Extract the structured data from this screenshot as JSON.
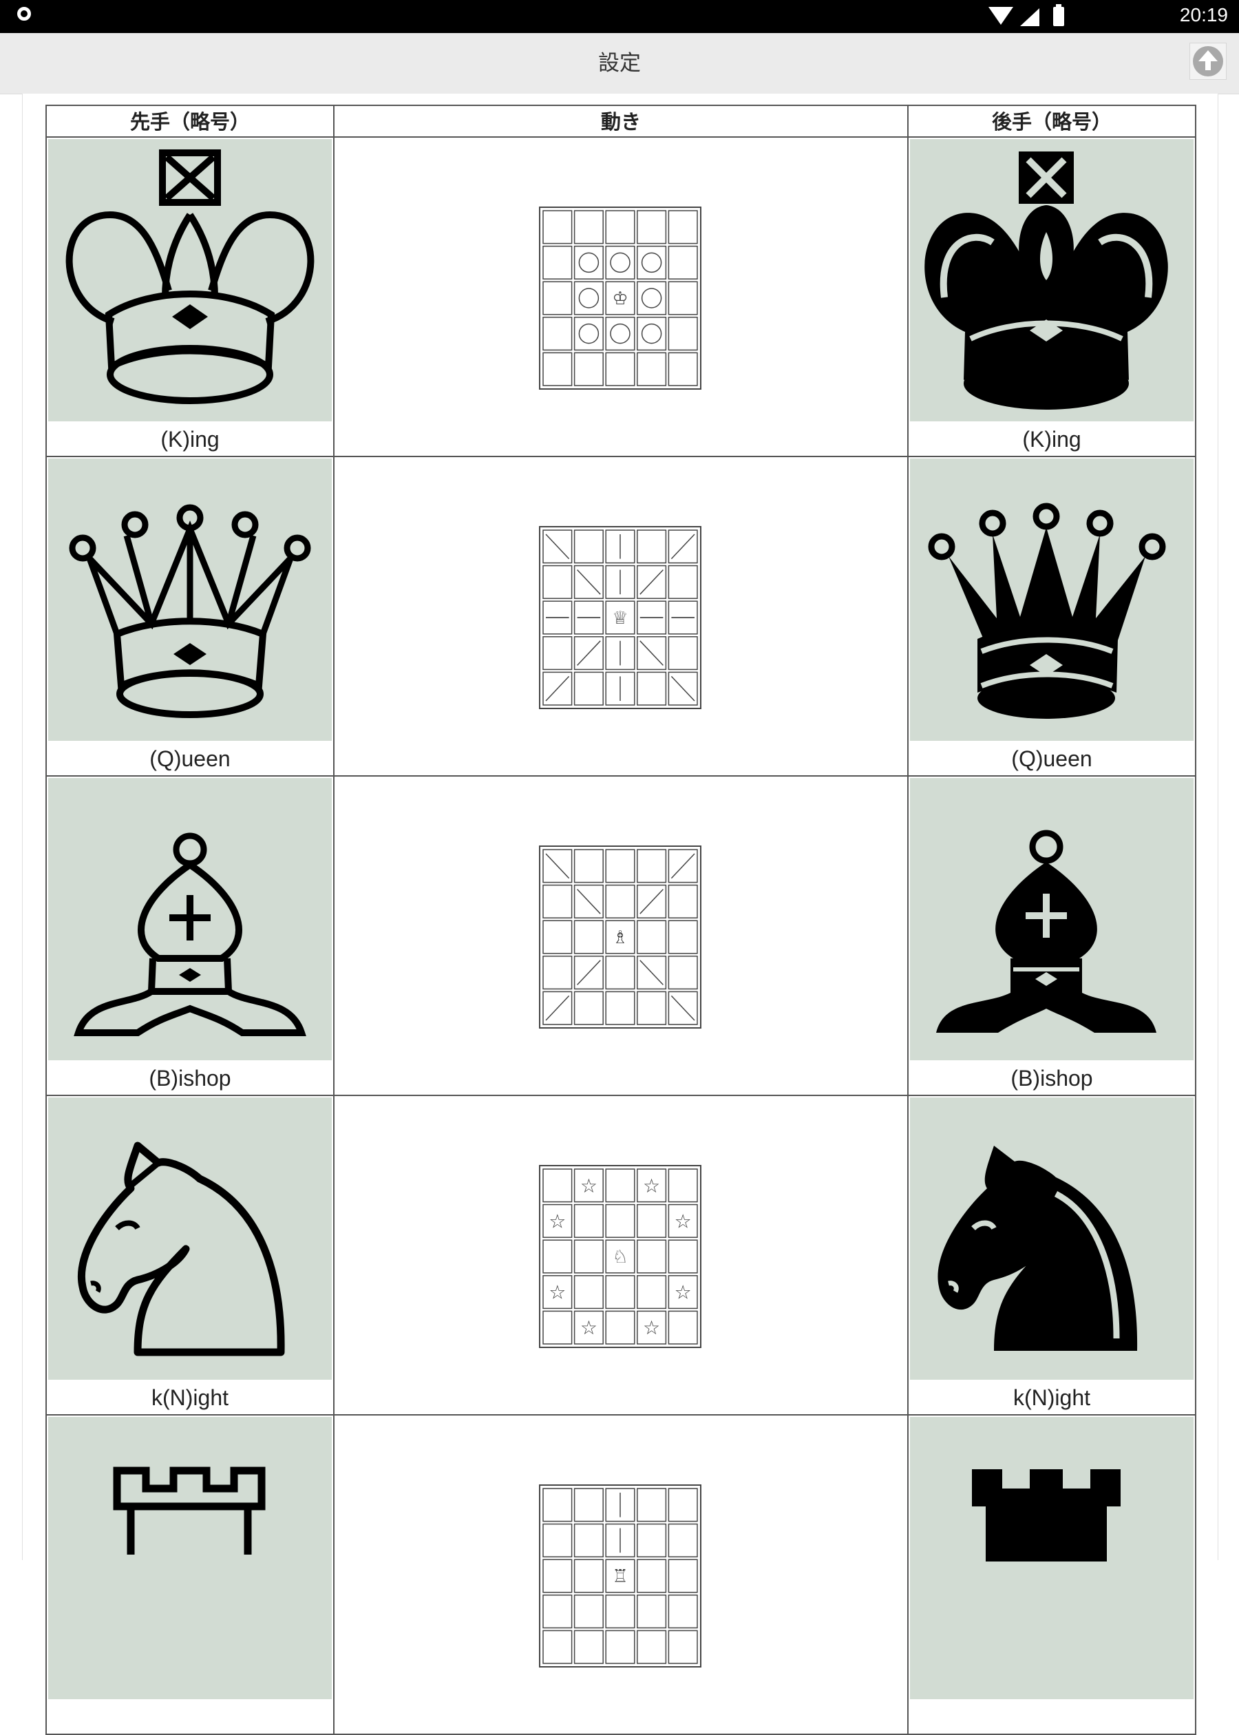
{
  "status_bar": {
    "time": "20:19"
  },
  "title_bar": {
    "title": "設定"
  },
  "table": {
    "headers": {
      "sente": "先手（略号）",
      "move": "動き",
      "gote": "後手（略号）"
    },
    "rows": [
      {
        "piece": "king",
        "sente_label": "(K)ing",
        "gote_label": "(K)ing",
        "move_glyph": "♔",
        "marks": [
          [
            1,
            1,
            "circle"
          ],
          [
            1,
            2,
            "circle"
          ],
          [
            1,
            3,
            "circle"
          ],
          [
            2,
            1,
            "circle"
          ],
          [
            2,
            3,
            "circle"
          ],
          [
            3,
            1,
            "circle"
          ],
          [
            3,
            2,
            "circle"
          ],
          [
            3,
            3,
            "circle"
          ]
        ]
      },
      {
        "piece": "queen",
        "sente_label": "(Q)ueen",
        "gote_label": "(Q)ueen",
        "move_glyph": "♕",
        "marks": [
          [
            0,
            0,
            "diag-down"
          ],
          [
            0,
            2,
            "vertical"
          ],
          [
            0,
            4,
            "diag-up"
          ],
          [
            1,
            1,
            "diag-down"
          ],
          [
            1,
            2,
            "vertical"
          ],
          [
            1,
            3,
            "diag-up"
          ],
          [
            2,
            0,
            "horizontal"
          ],
          [
            2,
            1,
            "horizontal"
          ],
          [
            2,
            3,
            "horizontal"
          ],
          [
            2,
            4,
            "horizontal"
          ],
          [
            3,
            1,
            "diag-up"
          ],
          [
            3,
            2,
            "vertical"
          ],
          [
            3,
            3,
            "diag-down"
          ],
          [
            4,
            0,
            "diag-up"
          ],
          [
            4,
            2,
            "vertical"
          ],
          [
            4,
            4,
            "diag-down"
          ]
        ]
      },
      {
        "piece": "bishop",
        "sente_label": "(B)ishop",
        "gote_label": "(B)ishop",
        "move_glyph": "♗",
        "marks": [
          [
            0,
            0,
            "diag-down"
          ],
          [
            0,
            4,
            "diag-up"
          ],
          [
            1,
            1,
            "diag-down"
          ],
          [
            1,
            3,
            "diag-up"
          ],
          [
            3,
            1,
            "diag-up"
          ],
          [
            3,
            3,
            "diag-down"
          ],
          [
            4,
            0,
            "diag-up"
          ],
          [
            4,
            4,
            "diag-down"
          ]
        ]
      },
      {
        "piece": "knight",
        "sente_label": "k(N)ight",
        "gote_label": "k(N)ight",
        "move_glyph": "♘",
        "marks": [
          [
            0,
            1,
            "star"
          ],
          [
            0,
            3,
            "star"
          ],
          [
            1,
            0,
            "star"
          ],
          [
            1,
            4,
            "star"
          ],
          [
            3,
            0,
            "star"
          ],
          [
            3,
            4,
            "star"
          ],
          [
            4,
            1,
            "star"
          ],
          [
            4,
            3,
            "star"
          ]
        ]
      },
      {
        "piece": "rook",
        "sente_label": "",
        "gote_label": "",
        "move_glyph": "♖",
        "marks": [
          [
            0,
            2,
            "vertical"
          ],
          [
            1,
            2,
            "vertical"
          ]
        ]
      }
    ]
  }
}
